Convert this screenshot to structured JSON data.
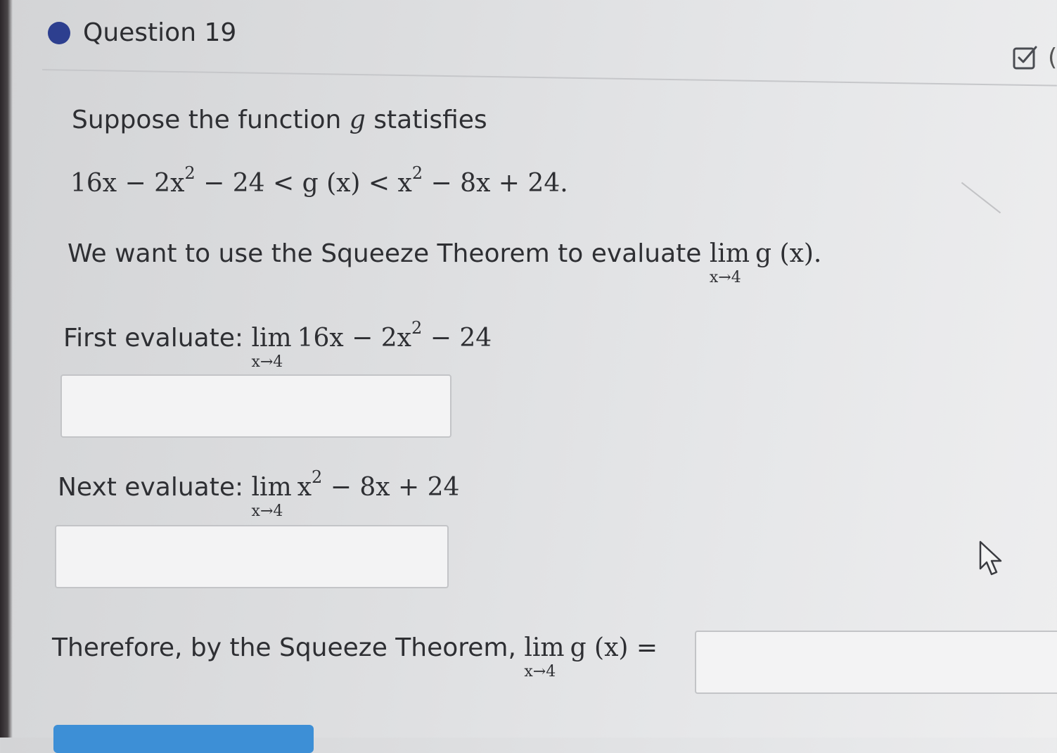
{
  "question": {
    "title": "Question 19",
    "status_color": "#2d3f8f"
  },
  "problem": {
    "intro_text": "Suppose the function ",
    "intro_var": "g",
    "intro_end": " statisfies",
    "inequality": {
      "left": "16x − 2x",
      "left_exp": "2",
      "left_tail": " − 24 < ",
      "middle": "g (x)",
      "middle_tail": " < x",
      "right_exp": "2",
      "right_tail": " − 8x + 24."
    },
    "goal_text": "We want to use the Squeeze Theorem to evaluate ",
    "goal_lim": "lim",
    "goal_sub": "x→4",
    "goal_expr": "g (x).",
    "first": {
      "label": "First evaluate: ",
      "lim": "lim",
      "sub": "x→4",
      "expr_a": "16x − 2x",
      "expr_exp": "2",
      "expr_b": " − 24"
    },
    "next": {
      "label": "Next evaluate: ",
      "lim": "lim",
      "sub": "x→4",
      "expr_a": "x",
      "expr_exp": "2",
      "expr_b": " − 8x + 24"
    },
    "conclusion": {
      "label": "Therefore, by the Squeeze Theorem, ",
      "lim": "lim",
      "sub": "x→4",
      "expr": "g (x)",
      "equals": " ="
    }
  },
  "inputs": {
    "first_value": "",
    "next_value": "",
    "final_value": ""
  },
  "icons": {
    "edit": "edit-checkbox-icon",
    "cursor": "mouse-pointer-icon"
  },
  "accent_color": "#3d8fd6"
}
